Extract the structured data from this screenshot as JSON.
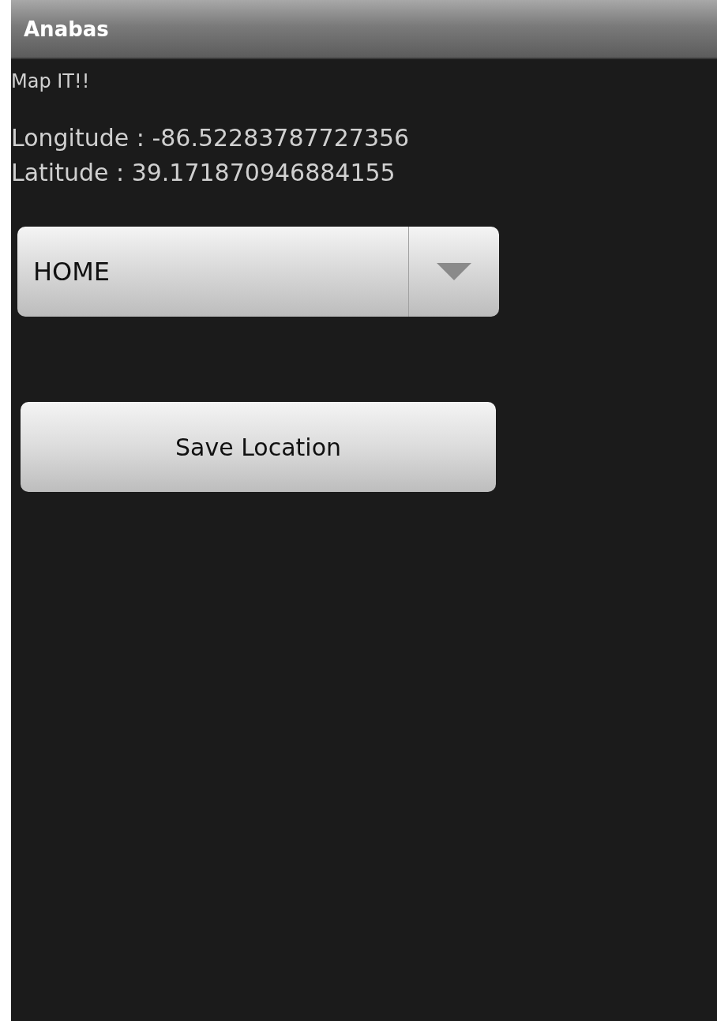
{
  "window": {
    "title": "Anabas"
  },
  "texts": [
    "Map IT!!",
    "Longitude : -86.52283787727356",
    "Latitude : 39.171870946884155"
  ],
  "dropdown": {
    "value": "HOME"
  },
  "buttons": [
    "Save Location"
  ]
}
